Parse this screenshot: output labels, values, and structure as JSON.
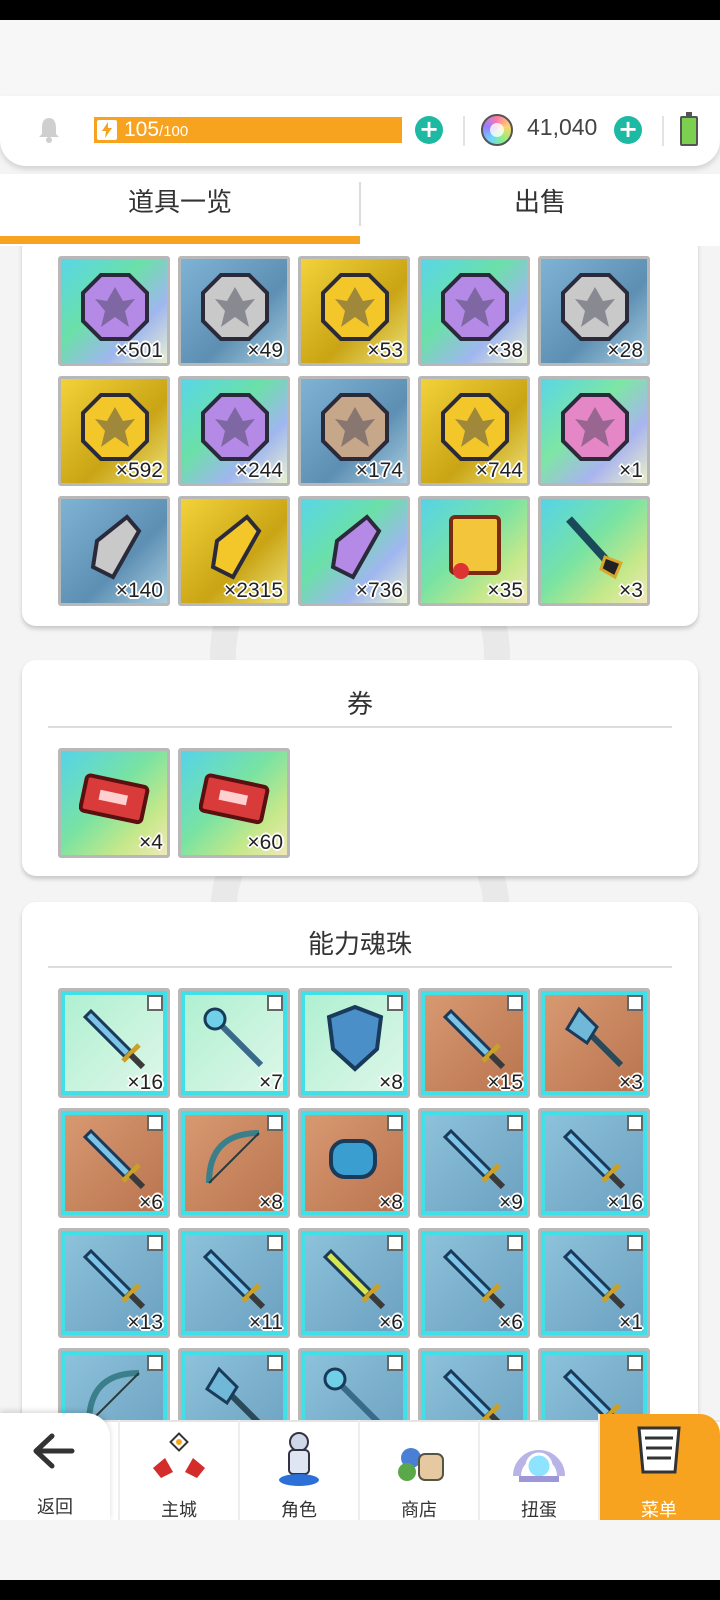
{
  "resources": {
    "stamina_current": "105",
    "stamina_max": "/100",
    "gems": "41,040"
  },
  "tabs": [
    {
      "label": "道具一览",
      "active": true
    },
    {
      "label": "出售",
      "active": false
    }
  ],
  "sections": [
    {
      "title": "",
      "items": [
        {
          "icon": "purple-dragon-medal-icon",
          "count": "×501"
        },
        {
          "icon": "silver-dragon-medal-icon",
          "count": "×49"
        },
        {
          "icon": "gold-dragon-medal-icon",
          "count": "×53"
        },
        {
          "icon": "purple-dragon-medal-icon",
          "count": "×38"
        },
        {
          "icon": "silver-tree-medal-icon",
          "count": "×28"
        },
        {
          "icon": "gold-tree-medal-icon",
          "count": "×592"
        },
        {
          "icon": "purple-tree-medal-icon",
          "count": "×244"
        },
        {
          "icon": "bronze-beast-medal-icon",
          "count": "×174"
        },
        {
          "icon": "gold-beast-medal-icon",
          "count": "×744"
        },
        {
          "icon": "rainbow-beast-medal-icon",
          "count": "×1"
        },
        {
          "icon": "silver-crystal-icon",
          "count": "×140"
        },
        {
          "icon": "gold-crystal-icon",
          "count": "×2315"
        },
        {
          "icon": "purple-crystal-icon",
          "count": "×736"
        },
        {
          "icon": "scroll-icon",
          "count": "×35"
        },
        {
          "icon": "wand-icon",
          "count": "×3"
        }
      ]
    },
    {
      "title": "券",
      "items": [
        {
          "icon": "ticket-stack-icon",
          "count": "×4"
        },
        {
          "icon": "ticket-icon",
          "count": "×60"
        }
      ]
    },
    {
      "title": "能力魂珠",
      "items": [
        {
          "icon": "sword-orb-icon",
          "count": "×16"
        },
        {
          "icon": "staff-orb-icon",
          "count": "×7"
        },
        {
          "icon": "shield-orb-icon",
          "count": "×8"
        },
        {
          "icon": "greatsword-orb-icon",
          "count": "×15"
        },
        {
          "icon": "axe-orb-icon",
          "count": "×3"
        },
        {
          "icon": "spear-orb-icon",
          "count": "×6"
        },
        {
          "icon": "bow-orb-icon",
          "count": "×8"
        },
        {
          "icon": "gauntlet-orb-icon",
          "count": "×8"
        },
        {
          "icon": "sword-orb-icon",
          "count": "×9"
        },
        {
          "icon": "sword-orb-icon",
          "count": "×16"
        },
        {
          "icon": "sword-orb-icon",
          "count": "×13"
        },
        {
          "icon": "sword-orb-icon",
          "count": "×11"
        },
        {
          "icon": "lightning-sword-orb-icon",
          "count": "×6"
        },
        {
          "icon": "sword-orb-icon",
          "count": "×6"
        },
        {
          "icon": "sword-orb-icon",
          "count": "×1"
        },
        {
          "icon": "bow-orb-icon",
          "count": ""
        },
        {
          "icon": "axe-orb-icon",
          "count": ""
        },
        {
          "icon": "rod-orb-icon",
          "count": ""
        },
        {
          "icon": "sword-orb-icon",
          "count": ""
        },
        {
          "icon": "sword-orb-icon",
          "count": ""
        }
      ]
    }
  ],
  "nav": [
    {
      "label": "返回",
      "icon": "back-arrow-icon"
    },
    {
      "label": "主城",
      "icon": "castle-icon"
    },
    {
      "label": "角色",
      "icon": "character-icon"
    },
    {
      "label": "商店",
      "icon": "shop-icon"
    },
    {
      "label": "扭蛋",
      "icon": "gacha-icon"
    },
    {
      "label": "菜单",
      "icon": "menu-icon",
      "active": true
    }
  ],
  "colors": {
    "accent": "#f8a31f",
    "plus_button": "#1db9a3"
  }
}
